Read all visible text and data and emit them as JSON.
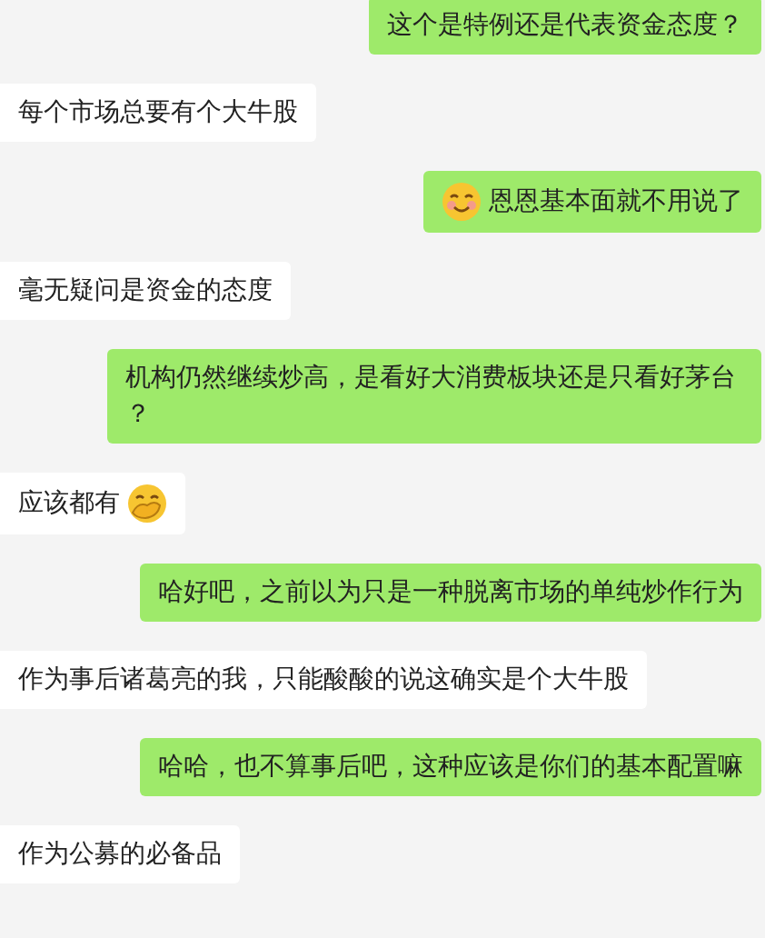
{
  "messages": [
    {
      "outgoing": true,
      "parts": [
        {
          "kind": "text",
          "text": "这个是特例还是代表资金态度？"
        }
      ]
    },
    {
      "outgoing": false,
      "parts": [
        {
          "kind": "text",
          "text": "每个市场总要有个大牛股"
        }
      ]
    },
    {
      "outgoing": true,
      "parts": [
        {
          "kind": "emoji-smile"
        },
        {
          "kind": "text",
          "text": "恩恩基本面就不用说了"
        }
      ]
    },
    {
      "outgoing": false,
      "parts": [
        {
          "kind": "text",
          "text": "毫无疑问是资金的态度"
        }
      ]
    },
    {
      "outgoing": true,
      "parts": [
        {
          "kind": "text",
          "text": "机构仍然继续炒高，是看好大消费板块还是只看好茅台？"
        }
      ]
    },
    {
      "outgoing": false,
      "parts": [
        {
          "kind": "text",
          "text": "应该都有"
        },
        {
          "kind": "emoji-cover-mouth"
        }
      ]
    },
    {
      "outgoing": true,
      "parts": [
        {
          "kind": "text",
          "text": "哈好吧，之前以为只是一种脱离市场的单纯炒作行为"
        }
      ]
    },
    {
      "outgoing": false,
      "parts": [
        {
          "kind": "text",
          "text": "作为事后诸葛亮的我，只能酸酸的说这确实是个大牛股"
        }
      ]
    },
    {
      "outgoing": true,
      "parts": [
        {
          "kind": "text",
          "text": "哈哈，也不算事后吧，这种应该是你们的基本配置嘛"
        }
      ]
    },
    {
      "outgoing": false,
      "parts": [
        {
          "kind": "text",
          "text": "作为公募的必备品"
        }
      ]
    }
  ]
}
